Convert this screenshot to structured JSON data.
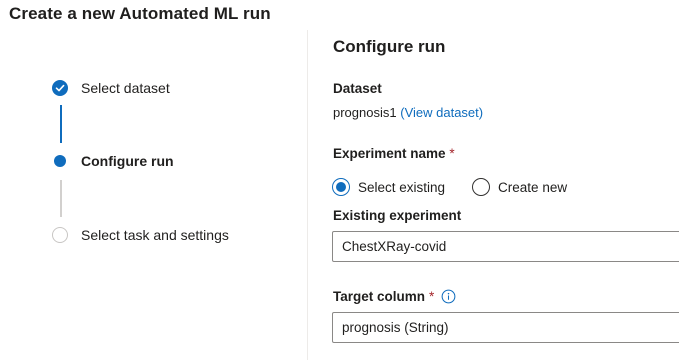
{
  "page": {
    "title": "Create a new Automated ML run"
  },
  "steps": [
    {
      "label": "Select dataset",
      "status": "completed"
    },
    {
      "label": "Configure run",
      "status": "current"
    },
    {
      "label": "Select task and settings",
      "status": "pending"
    }
  ],
  "panel": {
    "title": "Configure run",
    "dataset": {
      "label": "Dataset",
      "value": "prognosis1",
      "link": "(View dataset)"
    },
    "experiment": {
      "label": "Experiment name",
      "required_mark": "*",
      "options": [
        {
          "label": "Select existing",
          "selected": true
        },
        {
          "label": "Create new",
          "selected": false
        }
      ],
      "existing_label": "Existing experiment",
      "existing_value": "ChestXRay-covid"
    },
    "target": {
      "label": "Target column",
      "required_mark": "*",
      "value": "prognosis (String)"
    }
  },
  "colors": {
    "accent": "#0f6cbd",
    "required": "#a4262c",
    "pending": "#c8c6c4",
    "divider": "#edebe9"
  },
  "icons": {
    "completed_step": "checkmark-icon",
    "current_step": "current-step-icon",
    "pending_step": "pending-step-icon",
    "info": "info-icon"
  }
}
